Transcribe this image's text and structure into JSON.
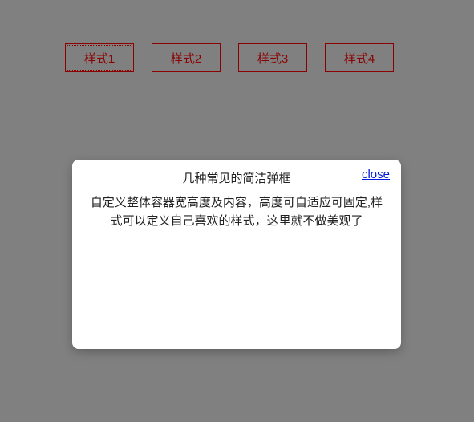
{
  "buttons": {
    "items": [
      {
        "label": "样式1"
      },
      {
        "label": "样式2"
      },
      {
        "label": "样式3"
      },
      {
        "label": "样式4"
      }
    ]
  },
  "modal": {
    "title": "几种常见的简洁弹框",
    "close_label": "close",
    "body": "自定义整体容器宽高度及内容，高度可自适应可固定,样式可以定义自己喜欢的样式，这里就不做美观了"
  }
}
